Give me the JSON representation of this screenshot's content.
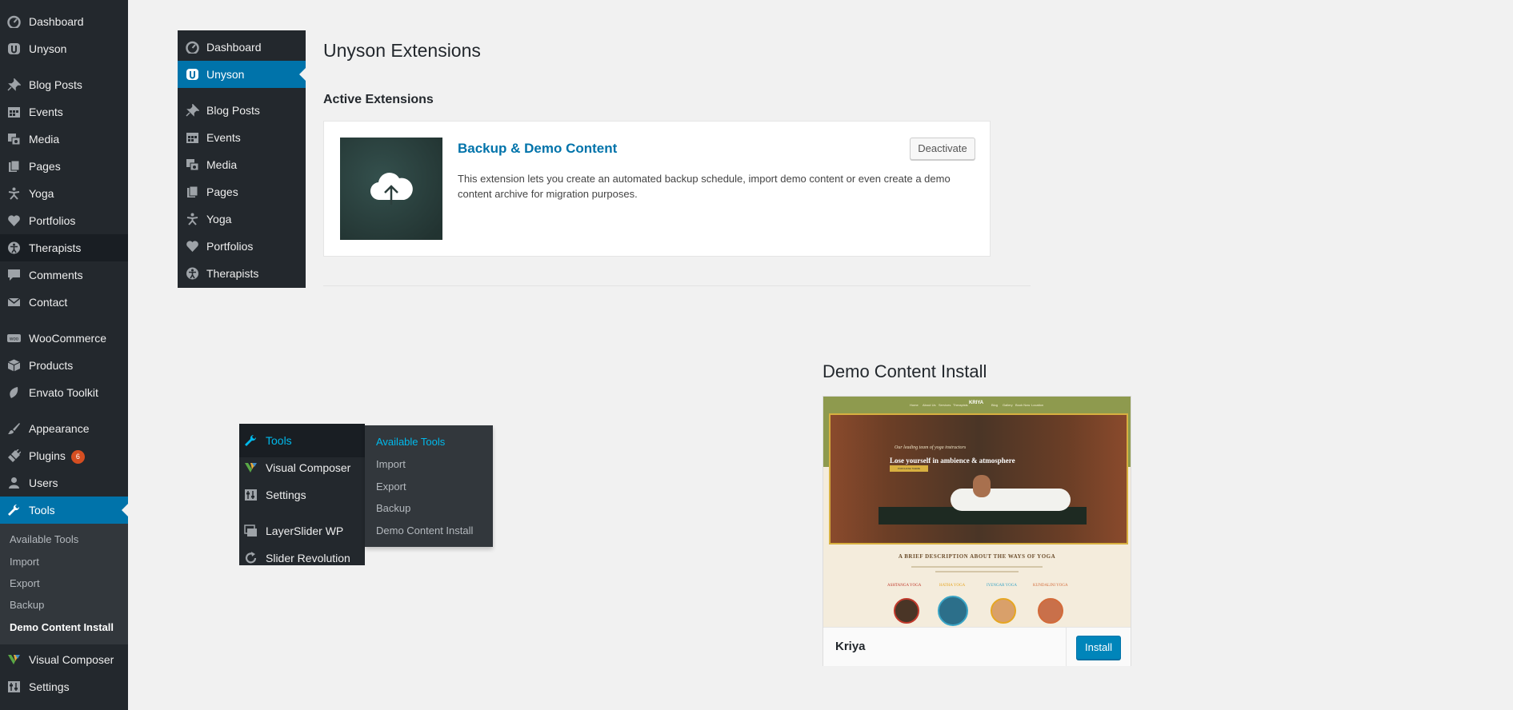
{
  "sidebar": {
    "items": [
      {
        "label": "Dashboard",
        "icon": "dashboard-icon"
      },
      {
        "label": "Unyson",
        "icon": "unyson-icon"
      },
      {
        "label": "Blog Posts",
        "icon": "pushpin-icon"
      },
      {
        "label": "Events",
        "icon": "calendar-icon"
      },
      {
        "label": "Media",
        "icon": "media-icon"
      },
      {
        "label": "Pages",
        "icon": "pages-icon"
      },
      {
        "label": "Yoga",
        "icon": "yoga-figure-icon"
      },
      {
        "label": "Portfolios",
        "icon": "heart-icon"
      },
      {
        "label": "Therapists",
        "icon": "universal-access-icon"
      },
      {
        "label": "Comments",
        "icon": "comment-icon"
      },
      {
        "label": "Contact",
        "icon": "mail-icon"
      },
      {
        "label": "WooCommerce",
        "icon": "woocommerce-icon"
      },
      {
        "label": "Products",
        "icon": "products-cube-icon"
      },
      {
        "label": "Envato Toolkit",
        "icon": "leaf-icon"
      },
      {
        "label": "Appearance",
        "icon": "paintbrush-icon"
      },
      {
        "label": "Plugins",
        "icon": "plugin-icon",
        "badge": "6"
      },
      {
        "label": "Users",
        "icon": "user-icon"
      },
      {
        "label": "Tools",
        "icon": "wrench-icon"
      },
      {
        "label": "Visual Composer",
        "icon": "visual-composer-icon"
      },
      {
        "label": "Settings",
        "icon": "settings-icon"
      }
    ],
    "submenu": [
      "Available Tools",
      "Import",
      "Export",
      "Backup",
      "Demo Content Install"
    ]
  },
  "mini_menu": {
    "items": [
      "Dashboard",
      "Unyson",
      "Blog Posts",
      "Events",
      "Media",
      "Pages",
      "Yoga",
      "Portfolios",
      "Therapists"
    ]
  },
  "main": {
    "title": "Unyson Extensions",
    "section_title": "Active Extensions",
    "extension": {
      "title": "Backup & Demo Content",
      "description": "This extension lets you create an automated backup schedule, import demo content or even create a demo content archive for migration purposes.",
      "deactivate_label": "Deactivate",
      "icon": "cloud-upload-icon"
    }
  },
  "tools_menu": {
    "items": [
      "Tools",
      "Visual Composer",
      "Settings",
      "LayerSlider WP",
      "Slider Revolution"
    ],
    "flyout": [
      "Available Tools",
      "Import",
      "Export",
      "Backup",
      "Demo Content Install"
    ]
  },
  "demo": {
    "title": "Demo Content Install",
    "name": "Kriya",
    "install_label": "Install",
    "screenshot": {
      "brand": "KRIYA",
      "kicker": "Our leading team of yoga instructors",
      "hero": "Lose yourself in ambience & atmosphere",
      "button": "PURCHASE THEME",
      "description": "A BRIEF DESCRIPTION ABOUT THE WAYS OF YOGA",
      "nav": [
        "Home",
        "About Us",
        "Services",
        "Therapists",
        "Blog",
        "Gallery",
        "Book Now",
        "Location"
      ],
      "yoga_types": [
        "ASHTANGA YOGA",
        "HATHA YOGA",
        "IYENGAR YOGA",
        "KUNDALINI YOGA"
      ]
    }
  },
  "colors": {
    "sidebar_bg": "#23282d",
    "active_bg": "#0073aa",
    "link": "#0073aa",
    "badge": "#d54e21",
    "flyout_current": "#00b9eb"
  }
}
